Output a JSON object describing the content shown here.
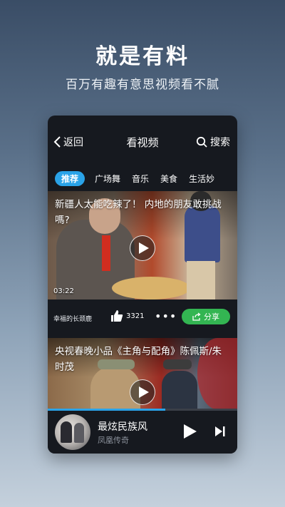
{
  "promo": {
    "headline": "就是有料",
    "subline": "百万有趣有意思视频看不腻"
  },
  "topbar": {
    "back_label": "返回",
    "title": "看视频",
    "search_label": "搜索"
  },
  "tabs": [
    {
      "label": "推荐",
      "active": true
    },
    {
      "label": "广场舞",
      "active": false
    },
    {
      "label": "音乐",
      "active": false
    },
    {
      "label": "美食",
      "active": false
    },
    {
      "label": "生活妙",
      "active": false
    }
  ],
  "videos": [
    {
      "title": "新疆人太能吃辣了！ 内地的朋友敢挑战嗎?",
      "duration": "03:22",
      "author": "幸福的长颈鹿",
      "likes": "3321",
      "more": "•••",
      "share_label": "分享"
    },
    {
      "title": "央视春晚小品《主角与配角》陈佩斯/朱时茂"
    }
  ],
  "player": {
    "song": "最炫民族风",
    "artist": "凤凰传奇",
    "progress": 0.62
  },
  "colors": {
    "accent": "#2aa3e8",
    "share_green": "#33b552",
    "card_bg": "#16191f"
  }
}
